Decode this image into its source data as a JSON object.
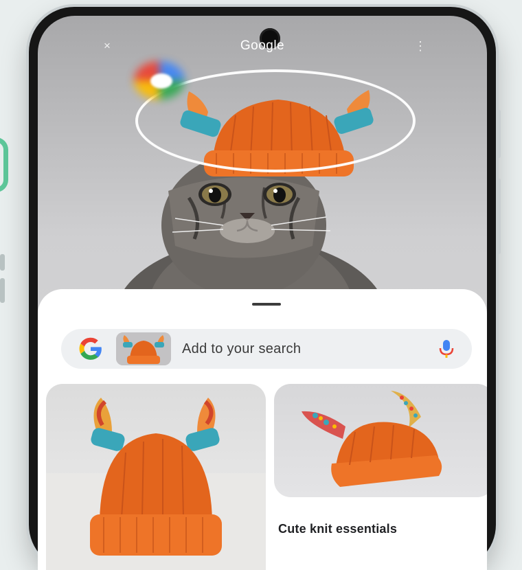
{
  "app": {
    "title": "Google"
  },
  "topbar": {
    "close_glyph": "×",
    "more_glyph": "⋮"
  },
  "search": {
    "placeholder": "Add to your search",
    "icon": "google-g-icon",
    "mic_icon": "mic-icon"
  },
  "results": [
    {
      "caption": ""
    },
    {
      "caption": "Cute knit essentials"
    }
  ],
  "colors": {
    "hat_orange": "#e3651d",
    "google_blue": "#4285f4",
    "google_red": "#ea4335",
    "google_yellow": "#fbbc05",
    "google_green": "#34a853",
    "horn_teal": "#3aa6b9"
  }
}
